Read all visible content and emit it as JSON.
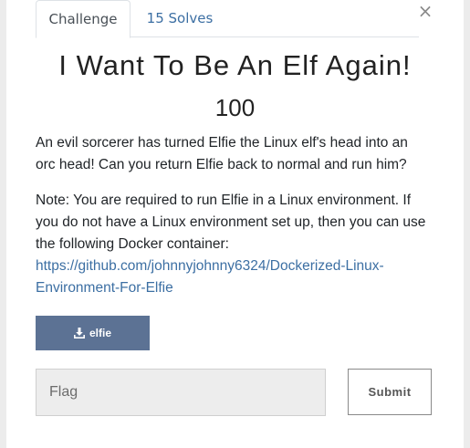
{
  "tabs": [
    {
      "label": "Challenge",
      "active": true
    },
    {
      "label": "15 Solves",
      "active": false
    }
  ],
  "close_symbol": "×",
  "challenge": {
    "title": "I Want To Be An Elf Again!",
    "points": "100",
    "description_1": "An evil sorcerer has turned Elfie the Linux elf's head into an orc head! Can you return Elfie back to normal and run him?",
    "description_2": "Note: You are required to run Elfie in a Linux environment. If you do not have a Linux environment set up, then you can use the following Docker container:",
    "link_text": "https://github.com/johnnyjohnny6324/Dockerized-Linux-Environment-For-Elfie",
    "file_label": "elfie",
    "file_icon": "download-icon"
  },
  "form": {
    "flag_placeholder": "Flag",
    "flag_value": "",
    "submit_label": "Submit"
  },
  "colors": {
    "accent": "#3c6fa3",
    "download_button": "#5c7294",
    "backdrop": "#ececec"
  }
}
